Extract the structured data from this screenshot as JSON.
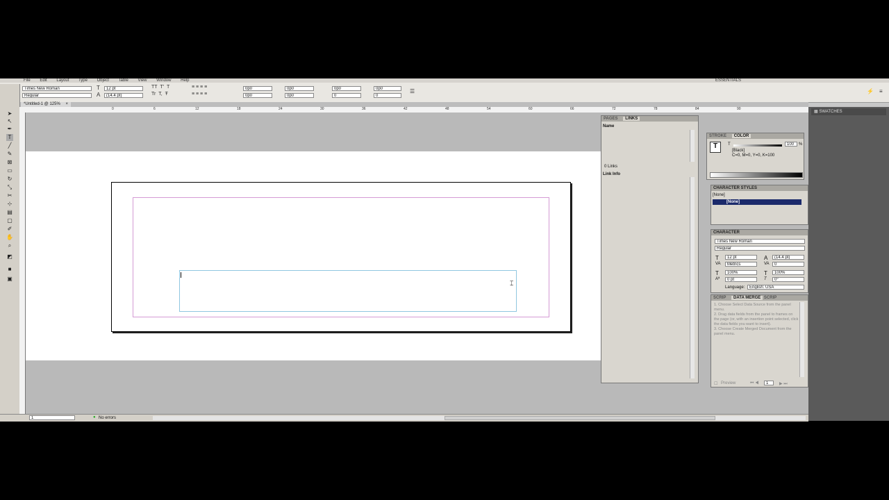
{
  "menu": [
    "File",
    "Edit",
    "Layout",
    "Type",
    "Object",
    "Table",
    "View",
    "Window",
    "Help"
  ],
  "workspace": "ESSENTIALS",
  "control": {
    "font": "Times New Roman",
    "style": "Regular",
    "size": "12 pt",
    "leading": "(14.4 pt)",
    "indent1": "0p0",
    "indent2": "0p0",
    "indent3": "0p0",
    "indent4": "0p0",
    "indent5": "0p0",
    "indent6": "0",
    "indent7": "0p0",
    "indent8": "0"
  },
  "doc_tab": "*Untitled-1 @ 125%",
  "ruler": [
    "0",
    "6",
    "12",
    "18",
    "24",
    "30",
    "36",
    "42",
    "48",
    "54",
    "60",
    "66",
    "72",
    "78",
    "84",
    "90"
  ],
  "status": {
    "page": "1",
    "errors": "No errors"
  },
  "links_panel": {
    "tabs": [
      "PAGES",
      "LINKS"
    ],
    "column": "Name",
    "count": "0 Links",
    "info": "Link Info"
  },
  "color_panel": {
    "tabs": [
      "STROKE",
      "COLOR"
    ],
    "tint_label": "T",
    "tint": "100",
    "pct": "%",
    "swatch": "[Black]",
    "cmyk": "C=0, M=0, Y=0, K=100"
  },
  "char_styles": {
    "title": "CHARACTER STYLES",
    "current": "[None]",
    "item": "[None]"
  },
  "character": {
    "title": "CHARACTER",
    "font": "Times New Roman",
    "style": "Regular",
    "size": "12 pt",
    "leading": "(14.4 pt)",
    "kerning": "Metrics",
    "tracking": "0",
    "vscale": "100%",
    "hscale": "100%",
    "baseline": "0 pt",
    "skew": "0°",
    "language_label": "Language:",
    "language": "English: USA"
  },
  "data_merge": {
    "tabs": [
      "SCRIP",
      "DATA MERGE",
      "SCRIP"
    ],
    "steps": "1. Choose Select Data Source from the panel menu.\n2. Drag data fields from the panel to frames on the page (or, with an insertion point selected, click the data fields you want to insert).\n3. Choose Create Merged Document from the panel menu.",
    "preview": "Preview",
    "record": "1"
  },
  "dock": {
    "swatches": "SWATCHES"
  }
}
